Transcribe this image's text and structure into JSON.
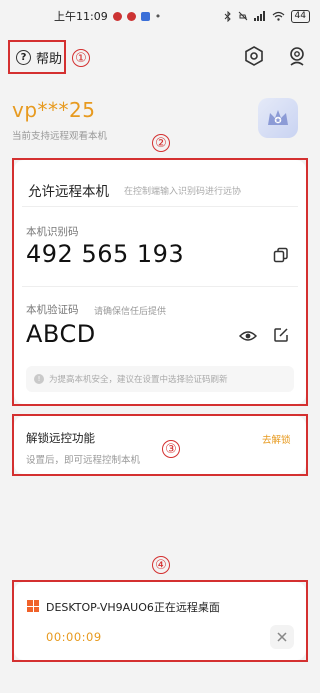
{
  "status_bar": {
    "time": "上午11:09",
    "extra": "•",
    "battery": "44"
  },
  "header": {
    "help_label": "帮助"
  },
  "annotations": {
    "m1": "①",
    "m2": "②",
    "m3": "③",
    "m4": "④"
  },
  "user": {
    "id": "vp***25",
    "subtitle": "当前支持远程观看本机"
  },
  "allow_remote": {
    "title": "允许远程本机",
    "hint": "在控制端输入识别码进行远协",
    "device_code_label": "本机识别码",
    "device_code": "492 565 193",
    "verify_label": "本机验证码",
    "verify_hint": "请确保信任后提供",
    "verify_code": "ABCD",
    "tip": "为提高本机安全，建议在设置中选择验证码刷新"
  },
  "unlock": {
    "title": "解锁远控功能",
    "subtitle": "设置后，即可远程控制本机",
    "action": "去解锁"
  },
  "session": {
    "name": "DESKTOP-VH9AUO6正在远程桌面",
    "elapsed": "00:00:09"
  },
  "colors": {
    "accent": "#e79a1f",
    "annotation": "#d43030",
    "windows_logo": "#f0622a"
  }
}
